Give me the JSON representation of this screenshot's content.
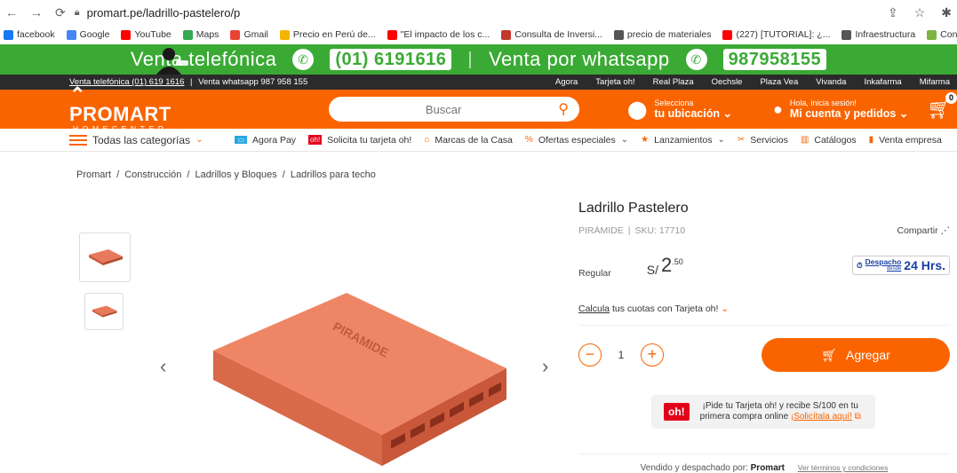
{
  "browser": {
    "url": "promart.pe/ladrillo-pastelero/p",
    "bookmarks": [
      {
        "label": "facebook",
        "color": "#1877f2",
        "icon": "facebook-icon"
      },
      {
        "label": "Google",
        "color": "#4285f4",
        "icon": "google-icon"
      },
      {
        "label": "YouTube",
        "color": "#ff0000",
        "icon": "youtube-icon"
      },
      {
        "label": "Maps",
        "color": "#34a853",
        "icon": "maps-icon"
      },
      {
        "label": "Gmail",
        "color": "#ea4335",
        "icon": "gmail-icon"
      },
      {
        "label": "Precio en Perú de...",
        "color": "#f4b400",
        "icon": "site-icon"
      },
      {
        "label": "\"El impacto de los c...",
        "color": "#ff0000",
        "icon": "youtube-icon"
      },
      {
        "label": "Consulta de Inversi...",
        "color": "#c0392b",
        "icon": "site-icon"
      },
      {
        "label": "precio de materiales",
        "color": "#555555",
        "icon": "globe-icon"
      },
      {
        "label": "(227) [TUTORIAL]: ¿...",
        "color": "#ff0000",
        "icon": "youtube-icon"
      },
      {
        "label": "Infraestructura",
        "color": "#555555",
        "icon": "globe-icon"
      },
      {
        "label": "Controlar los costos...",
        "color": "#7cb342",
        "icon": "site-icon"
      }
    ]
  },
  "banner": {
    "left_text": "Venta telefónica",
    "phone": "(01) 6191616",
    "separator": "|",
    "right_text": "Venta por whatsapp",
    "whatsapp": "987958155"
  },
  "topbar": {
    "phone_link": "Venta telefónica (01) 619 1616",
    "divider": "|",
    "whatsapp_text": "Venta whatsapp 987 958 155",
    "links": [
      "Agora",
      "Tarjeta oh!",
      "Real Plaza",
      "Oechsle",
      "Plaza Vea",
      "Vivanda",
      "Inkafarma",
      "Mifarma"
    ]
  },
  "header": {
    "brand": "PROMART",
    "brand_sub": "HOMECENTER",
    "search_placeholder": "Buscar",
    "location_top": "Selecciona",
    "location_bottom": "tu ubicación",
    "account_top": "Hola, inicia sesión!",
    "account_bottom": "Mi cuenta y pedidos",
    "cart_count": "0"
  },
  "catnav": {
    "main": "Todas las categorías",
    "items": [
      {
        "label": "Agora Pay",
        "icon": "agora-icon"
      },
      {
        "label": "Solicita tu tarjeta oh!",
        "icon": "oh-icon"
      },
      {
        "label": "Marcas de la Casa",
        "icon": "house-brand-icon"
      },
      {
        "label": "Ofertas especiales",
        "icon": "percent-icon"
      },
      {
        "label": "Lanzamientos",
        "icon": "star-icon"
      },
      {
        "label": "Servicios",
        "icon": "tools-icon"
      },
      {
        "label": "Catálogos",
        "icon": "book-icon"
      },
      {
        "label": "Venta empresa",
        "icon": "bars-icon"
      }
    ]
  },
  "breadcrumb": [
    "Promart",
    "Construcción",
    "Ladrillos y Bloques",
    "Ladrillos para techo"
  ],
  "breadcrumb_sep": "/",
  "product": {
    "title": "Ladrillo Pastelero",
    "brand": "PIRÁMIDE",
    "meta_sep": "|",
    "sku": "SKU: 17710",
    "share": "Compartir",
    "price_label": "Regular",
    "currency": "S/",
    "price_int": "2",
    "price_dec": ".50",
    "despacho": "Despacho",
    "despacho_sub": "desde",
    "despacho_hrs": "24 Hrs.",
    "calc_link": "Calcula",
    "calc_text": "tus cuotas con Tarjeta oh!",
    "quantity": "1",
    "add_label": "Agregar",
    "promo_badge": "oh!",
    "promo_line1": "¡Pide tu Tarjeta oh! y recibe S/100 en tu",
    "promo_line2": "primera compra online",
    "promo_link": "¡Solicítala aquí!",
    "sold_by": "Vendido y despachado por:",
    "seller": "Promart",
    "terms": "Ver términos y condiciones",
    "image_text": "PIRAMIDE"
  },
  "colors": {
    "brand": "#fa6400",
    "green": "#3aaa35",
    "brick": "#e8795a"
  }
}
